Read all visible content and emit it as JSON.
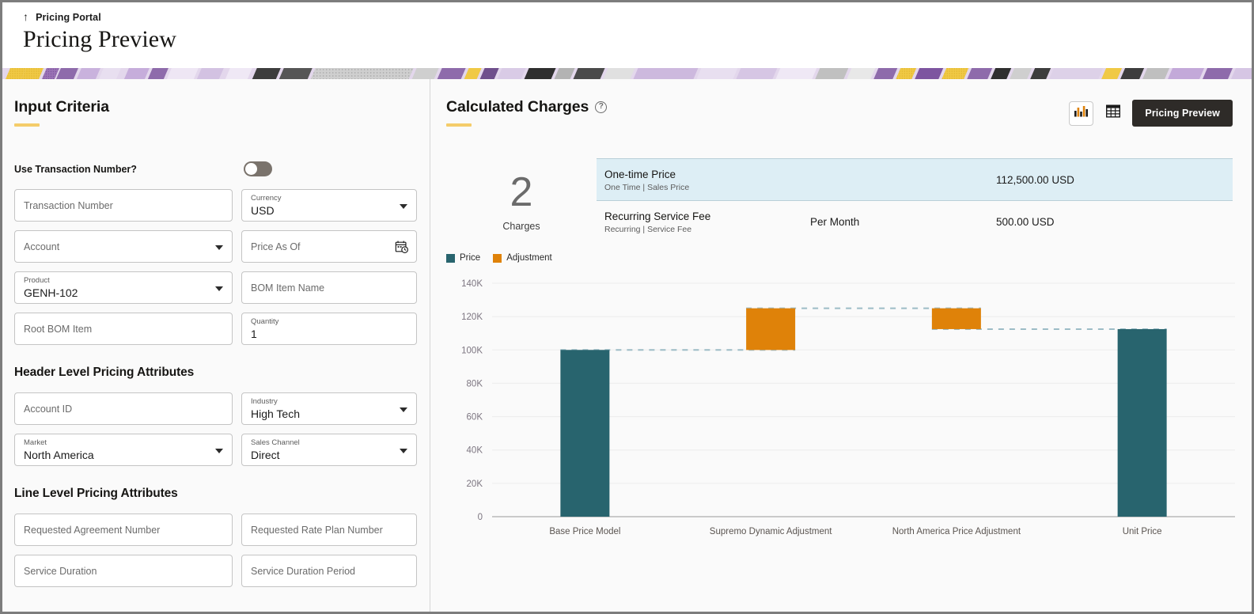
{
  "header": {
    "breadcrumb": "Pricing Portal",
    "back_icon": "up-arrow-icon",
    "title": "Pricing Preview"
  },
  "left_panel": {
    "section_title": "Input Criteria",
    "toggle": {
      "label": "Use Transaction Number?",
      "state": "off"
    },
    "fields": [
      {
        "name": "transaction-number",
        "label": "",
        "placeholder": "Transaction Number",
        "value": "",
        "type": "text"
      },
      {
        "name": "currency",
        "label": "Currency",
        "placeholder": "",
        "value": "USD",
        "type": "select"
      },
      {
        "name": "account",
        "label": "",
        "placeholder": "Account",
        "value": "",
        "type": "select"
      },
      {
        "name": "price-as-of",
        "label": "",
        "placeholder": "Price As Of",
        "value": "",
        "type": "date"
      },
      {
        "name": "product",
        "label": "Product",
        "placeholder": "",
        "value": "GENH-102",
        "type": "select"
      },
      {
        "name": "bom-item-name",
        "label": "",
        "placeholder": "BOM Item Name",
        "value": "",
        "type": "text"
      },
      {
        "name": "root-bom-item",
        "label": "",
        "placeholder": "Root BOM Item",
        "value": "",
        "type": "text"
      },
      {
        "name": "quantity",
        "label": "Quantity",
        "placeholder": "",
        "value": "1",
        "type": "text"
      }
    ],
    "header_attrs_title": "Header Level Pricing Attributes",
    "header_attrs": [
      {
        "name": "account-id",
        "label": "",
        "placeholder": "Account ID",
        "value": "",
        "type": "text"
      },
      {
        "name": "industry",
        "label": "Industry",
        "placeholder": "",
        "value": "High Tech",
        "type": "select"
      },
      {
        "name": "market",
        "label": "Market",
        "placeholder": "",
        "value": "North America",
        "type": "select"
      },
      {
        "name": "sales-channel",
        "label": "Sales Channel",
        "placeholder": "",
        "value": "Direct",
        "type": "select"
      }
    ],
    "line_attrs_title": "Line Level Pricing Attributes",
    "line_attrs": [
      {
        "name": "requested-agreement-number",
        "label": "",
        "placeholder": "Requested Agreement Number",
        "value": "",
        "type": "text"
      },
      {
        "name": "requested-rate-plan-number",
        "label": "",
        "placeholder": "Requested Rate Plan Number",
        "value": "",
        "type": "text"
      },
      {
        "name": "service-duration",
        "label": "",
        "placeholder": "Service Duration",
        "value": "",
        "type": "text"
      },
      {
        "name": "service-duration-period",
        "label": "",
        "placeholder": "Service Duration Period",
        "value": "",
        "type": "text"
      }
    ]
  },
  "right_panel": {
    "section_title": "Calculated Charges",
    "help_glyph": "?",
    "toolbar": {
      "chart_view_icon": "bar-chart-icon",
      "table_view_icon": "table-grid-icon",
      "primary_button": "Pricing Preview"
    },
    "summary": {
      "count": "2",
      "count_label": "Charges"
    },
    "charges": [
      {
        "title": "One-time Price",
        "subtitle": "One Time | Sales Price",
        "period": "",
        "amount": "112,500.00 USD",
        "highlighted": true
      },
      {
        "title": "Recurring Service Fee",
        "subtitle": "Recurring | Service Fee",
        "period": "Per Month",
        "amount": "500.00 USD",
        "highlighted": false
      }
    ]
  },
  "colors": {
    "price": "#28646e",
    "adjustment": "#df8209",
    "accent": "#f4cc6a",
    "highlight_row": "#ddeef5",
    "primary_button": "#2e2b28"
  },
  "chart_data": {
    "type": "bar",
    "subtype": "waterfall",
    "title": "",
    "xlabel": "",
    "ylabel": "",
    "ylim": [
      0,
      140000
    ],
    "yticks": [
      0,
      20000,
      40000,
      60000,
      80000,
      100000,
      120000,
      140000
    ],
    "ytick_labels": [
      "0",
      "20K",
      "40K",
      "60K",
      "80K",
      "100K",
      "120K",
      "140K"
    ],
    "grid": true,
    "legend_position": "top-left",
    "legend": [
      {
        "name": "Price",
        "color": "#28646e"
      },
      {
        "name": "Adjustment",
        "color": "#df8209"
      }
    ],
    "categories": [
      "Base Price Model",
      "Supremo Dynamic Adjustment",
      "North America Price Adjustment",
      "Unit Price"
    ],
    "bars": [
      {
        "category": "Base Price Model",
        "series": "Price",
        "start": 0,
        "end": 100000,
        "value": 100000
      },
      {
        "category": "Supremo Dynamic Adjustment",
        "series": "Adjustment",
        "start": 100000,
        "end": 125000,
        "value": 25000
      },
      {
        "category": "North America Price Adjustment",
        "series": "Adjustment",
        "start": 112500,
        "end": 125000,
        "value": -12500
      },
      {
        "category": "Unit Price",
        "series": "Price",
        "start": 0,
        "end": 112500,
        "value": 112500
      }
    ],
    "connectors": [
      {
        "from": "Base Price Model",
        "to": "Supremo Dynamic Adjustment",
        "y": 100000
      },
      {
        "from": "Supremo Dynamic Adjustment",
        "to": "North America Price Adjustment",
        "y": 125000
      },
      {
        "from": "North America Price Adjustment",
        "to": "Unit Price",
        "y": 112500
      }
    ]
  }
}
